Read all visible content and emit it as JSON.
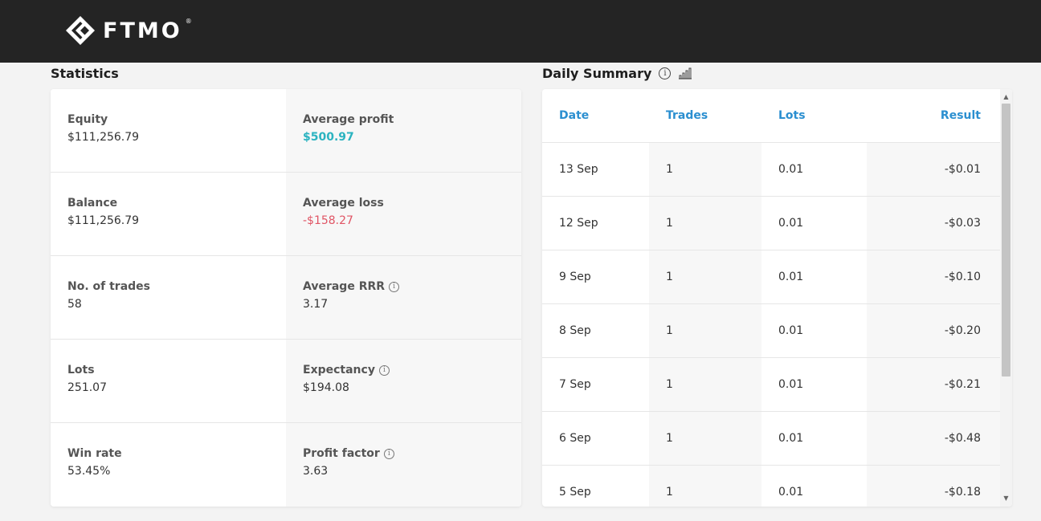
{
  "brand": {
    "name": "FTMO",
    "reg": "®"
  },
  "statistics": {
    "title": "Statistics",
    "rows": [
      {
        "left": {
          "label": "Equity",
          "value": "$111,256.79"
        },
        "right": {
          "label": "Average profit",
          "value": "$500.97",
          "info": false
        }
      },
      {
        "left": {
          "label": "Balance",
          "value": "$111,256.79"
        },
        "right": {
          "label": "Average loss",
          "value": "-$158.27",
          "info": false
        }
      },
      {
        "left": {
          "label": "No. of trades",
          "value": "58"
        },
        "right": {
          "label": "Average RRR",
          "value": "3.17",
          "info": true
        }
      },
      {
        "left": {
          "label": "Lots",
          "value": "251.07"
        },
        "right": {
          "label": "Expectancy",
          "value": "$194.08",
          "info": true
        }
      },
      {
        "left": {
          "label": "Win rate",
          "value": "53.45%"
        },
        "right": {
          "label": "Profit factor",
          "value": "3.63",
          "info": true
        }
      }
    ]
  },
  "daily_summary": {
    "title": "Daily Summary",
    "columns": {
      "date": "Date",
      "trades": "Trades",
      "lots": "Lots",
      "result": "Result"
    },
    "rows": [
      {
        "date": "13 Sep",
        "trades": "1",
        "lots": "0.01",
        "result": "-$0.01"
      },
      {
        "date": "12 Sep",
        "trades": "1",
        "lots": "0.01",
        "result": "-$0.03"
      },
      {
        "date": "9 Sep",
        "trades": "1",
        "lots": "0.01",
        "result": "-$0.10"
      },
      {
        "date": "8 Sep",
        "trades": "1",
        "lots": "0.01",
        "result": "-$0.20"
      },
      {
        "date": "7 Sep",
        "trades": "1",
        "lots": "0.01",
        "result": "-$0.21"
      },
      {
        "date": "6 Sep",
        "trades": "1",
        "lots": "0.01",
        "result": "-$0.48"
      },
      {
        "date": "5 Sep",
        "trades": "1",
        "lots": "0.01",
        "result": "-$0.18"
      }
    ]
  },
  "icons": {
    "info": "info-icon",
    "chart": "bar-chart-icon",
    "logo": "ftmo-logo-icon"
  },
  "colors": {
    "header_bg": "#242424",
    "positive": "#2bb3c0",
    "negative": "#e05565",
    "column_header": "#2b8fd0"
  }
}
